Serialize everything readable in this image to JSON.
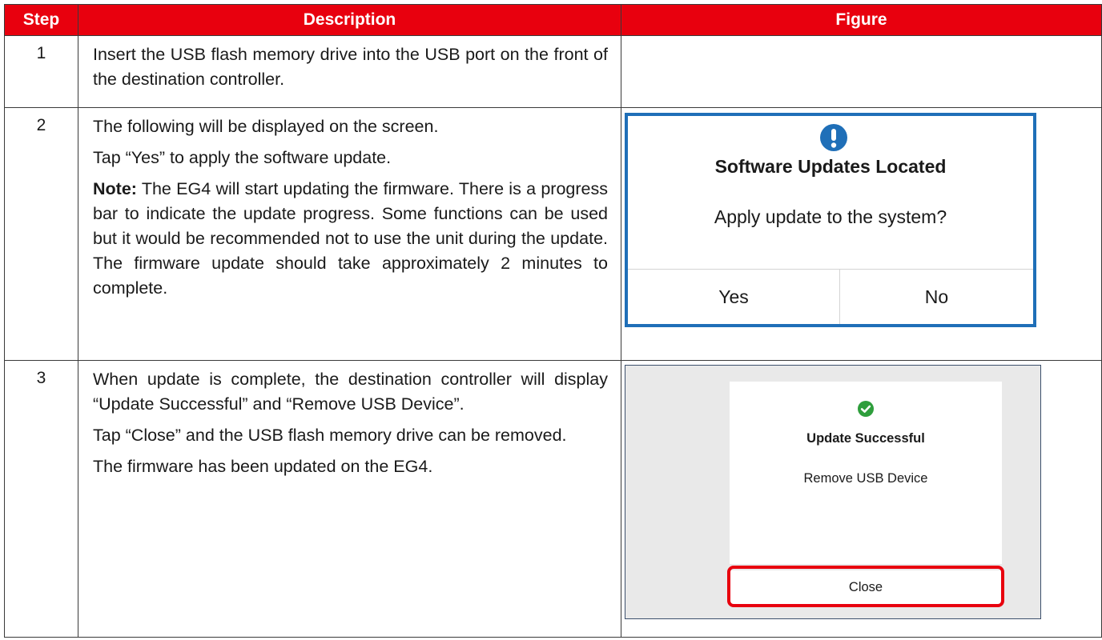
{
  "table": {
    "headers": {
      "step": "Step",
      "description": "Description",
      "figure": "Figure"
    },
    "rows": [
      {
        "step": "1",
        "paragraphs": [
          "Insert the USB flash memory drive into the USB port on the front of the destination controller."
        ]
      },
      {
        "step": "2",
        "paragraphs": [
          "The following will be displayed on the screen.",
          "Tap “Yes” to apply the software update."
        ],
        "note_label": "Note:",
        "note_text": " The EG4 will start updating the firmware. There is a progress bar to indicate the update progress. Some functions can be used but it would be recommended not to use the unit during the update. The firmware update should take approximately 2 minutes to complete."
      },
      {
        "step": "3",
        "paragraphs": [
          "When update is complete, the destination controller will display “Update Successful” and “Remove USB Device”.",
          "Tap “Close” and the USB flash memory drive can be removed.",
          "The firmware has been updated on the EG4."
        ]
      }
    ]
  },
  "figure_update_located": {
    "icon": "exclamation-circle-icon",
    "title": "Software Updates Located",
    "message": "Apply update to the system?",
    "yes_label": "Yes",
    "no_label": "No",
    "border_color": "#1f6fb8"
  },
  "figure_update_success": {
    "icon": "check-circle-icon",
    "title": "Update Successful",
    "message": "Remove USB Device",
    "close_label": "Close",
    "highlight_color": "#e8000e",
    "check_color": "#2e9e3c"
  },
  "colors": {
    "header_bg": "#e8000e",
    "header_text": "#ffffff"
  }
}
